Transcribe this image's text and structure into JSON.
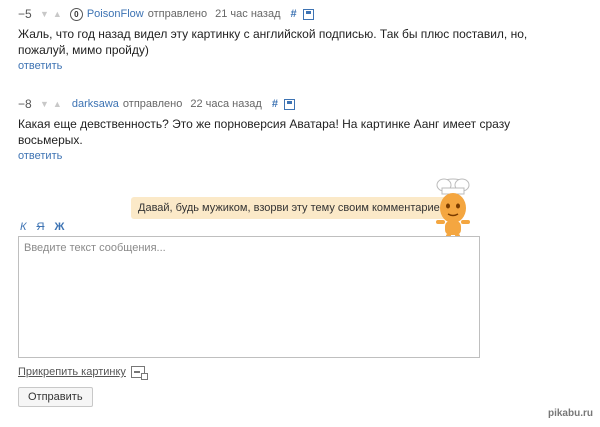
{
  "comments": [
    {
      "rating": "−5",
      "author": "PoisonFlow",
      "sent_label": "отправлено",
      "time": "21 час назад",
      "hash": "#",
      "text": "Жаль, что год назад видел эту картинку с английской подписью. Так бы плюс поставил, но, пожалуй, мимо пройду)",
      "reply_label": "ответить"
    },
    {
      "rating": "−8",
      "author": "darksawa",
      "sent_label": "отправлено",
      "time": "22 часа назад",
      "hash": "#",
      "text": "Какая еще девственность? Это же порноверсия Аватара! На картинке Аанг имеет сразу восьмерых.",
      "reply_label": "ответить"
    }
  ],
  "mascot_tooltip": "Давай, будь мужиком, взорви эту тему своим комментарием",
  "format_buttons": {
    "italic": "К",
    "strike": "Я",
    "bold": "Ж"
  },
  "editor": {
    "placeholder": "Введите текст сообщения..."
  },
  "attach_label": "Прикрепить картинку",
  "submit_label": "Отправить",
  "watermark": "pikabu.ru",
  "colors": {
    "link": "#3d73b3",
    "tooltip_bg": "#fbe9c8",
    "mascot": "#f4a640"
  }
}
